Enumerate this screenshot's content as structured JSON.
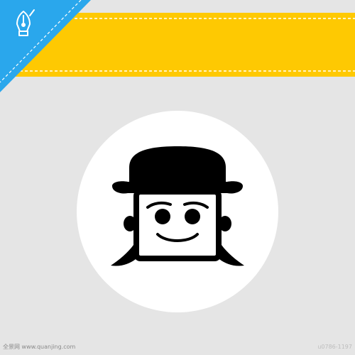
{
  "colors": {
    "background": "#e5e5e5",
    "banner": "#fec902",
    "banner_stitch": "#ffffff",
    "corner_ribbon": "#2aa7ec",
    "circle": "#ffffff",
    "ink": "#000000"
  },
  "icons": {
    "corner": "pen-nib-icon",
    "avatar": "man-with-hat-icon"
  },
  "watermark": {
    "site": "全景网 www.quanjing.com",
    "id": "u0786-1197"
  }
}
